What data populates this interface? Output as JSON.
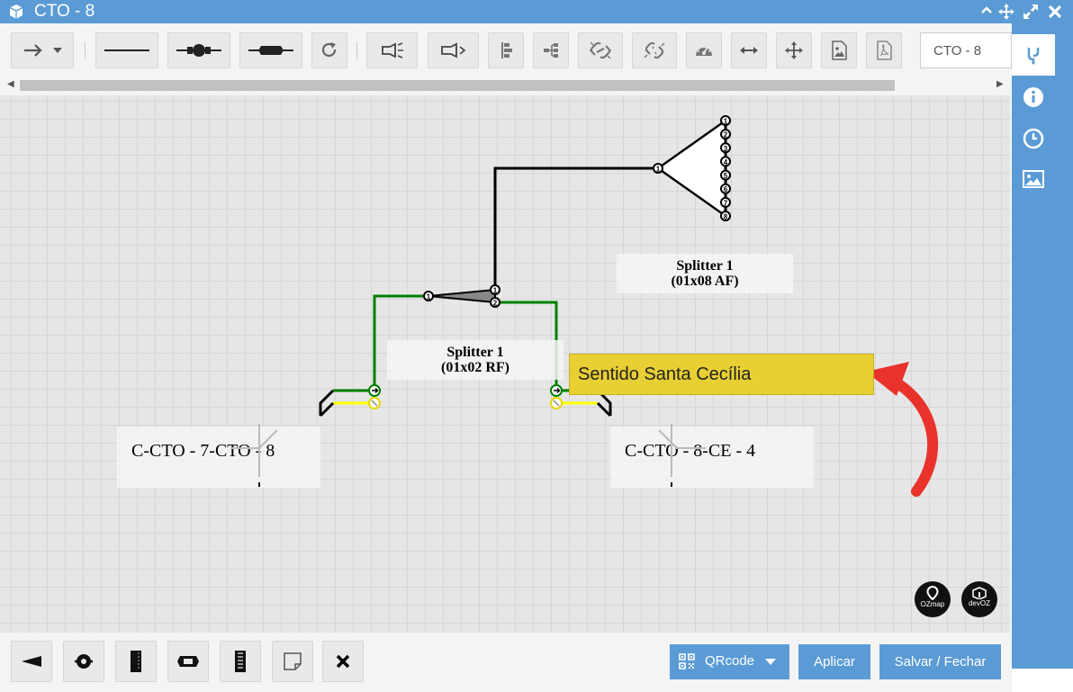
{
  "window": {
    "title": "CTO - 8",
    "colors": {
      "chrome": "#5b9bd5",
      "canvas": "#e6e6e6",
      "note": "#e8cf33",
      "fiber_green": "#008000",
      "fiber_yellow": "#ffff00",
      "arrow": "#e8322b"
    }
  },
  "toolbar": {
    "name_value": "CTO - 8",
    "icons": [
      "arrow-select-icon",
      "dropdown-caret-icon",
      "line-icon",
      "splice-closure-icon",
      "connector-icon",
      "redo-icon",
      "light-source-icon",
      "power-meter-icon",
      "align-left-icon",
      "align-tree-icon",
      "link-icon",
      "unlink-icon",
      "speedometer-icon",
      "horizontal-arrows-icon",
      "move-icon",
      "image-icon",
      "pdf-icon"
    ]
  },
  "sidebar": {
    "icons": [
      "fiber-branch-icon",
      "info-icon",
      "clock-icon",
      "picture-icon"
    ]
  },
  "diagram": {
    "splitter_af": {
      "name": "Splitter 1",
      "type": "(01x08 AF)",
      "port_in": "1",
      "ports_out": [
        "1",
        "2",
        "3",
        "4",
        "5",
        "6",
        "7",
        "8"
      ]
    },
    "splitter_rf": {
      "name": "Splitter 1",
      "type": "(01x02 RF)",
      "port_in": "1",
      "ports_out": [
        "1",
        "2"
      ]
    },
    "cable_left": {
      "label": "C-CTO - 7-CTO - 8"
    },
    "cable_right": {
      "label": "C-CTO - 8-CE - 4"
    },
    "note": {
      "text": "Sentido Santa Cecília"
    },
    "logos": {
      "left": "OZmap",
      "right": "devOZ"
    }
  },
  "bottom_bar": {
    "tool_icons": [
      "splitter-tool-icon",
      "closure-tool-icon",
      "cable-tool-icon",
      "connector-tool-icon",
      "dio-tool-icon",
      "note-tool-icon",
      "delete-tool-icon"
    ],
    "qrcode_label": "QRcode",
    "apply_label": "Aplicar",
    "save_close_label": "Salvar / Fechar"
  }
}
